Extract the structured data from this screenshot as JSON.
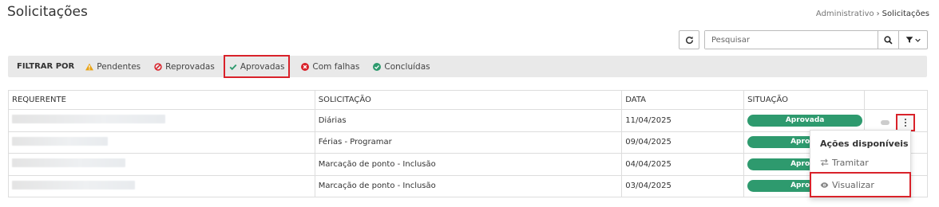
{
  "header": {
    "title": "Solicitações",
    "breadcrumb": [
      "Administrativo",
      "Solicitações"
    ]
  },
  "toolbar": {
    "search_placeholder": "Pesquisar",
    "refresh_icon": "refresh-icon",
    "search_icon": "search-icon",
    "filter_icon": "filter-icon"
  },
  "filter_bar": {
    "label": "FILTRAR POR",
    "items": [
      {
        "label": "Pendentes",
        "icon": "warning-icon",
        "color": "#e8a317"
      },
      {
        "label": "Reprovadas",
        "icon": "ban-icon",
        "color": "#d9222a"
      },
      {
        "label": "Aprovadas",
        "icon": "check-icon",
        "color": "#2e9a6e",
        "selected": true
      },
      {
        "label": "Com falhas",
        "icon": "error-circle-icon",
        "color": "#d9222a"
      },
      {
        "label": "Concluídas",
        "icon": "check-circle-icon",
        "color": "#2e9a6e"
      }
    ]
  },
  "table": {
    "columns": [
      "REQUERENTE",
      "SOLICITAÇÃO",
      "DATA",
      "SITUAÇÃO",
      ""
    ],
    "rows": [
      {
        "requerente": "",
        "solicitacao": "Diárias",
        "data": "11/04/2025",
        "situacao": "Aprovada"
      },
      {
        "requerente": "",
        "solicitacao": "Férias - Programar",
        "data": "09/04/2025",
        "situacao": "Aprova"
      },
      {
        "requerente": "",
        "solicitacao": "Marcação de ponto - Inclusão",
        "data": "04/04/2025",
        "situacao": "Aprova"
      },
      {
        "requerente": "",
        "solicitacao": "Marcação de ponto - Inclusão",
        "data": "03/04/2025",
        "situacao": "Aprova"
      }
    ]
  },
  "actions_menu": {
    "title": "Ações disponíveis",
    "items": [
      {
        "label": "Tramitar",
        "icon": "exchange-icon"
      },
      {
        "label": "Visualizar",
        "icon": "eye-icon",
        "selected": true
      }
    ]
  },
  "colors": {
    "approved": "#2e9a6e",
    "highlight": "#d9222a"
  }
}
